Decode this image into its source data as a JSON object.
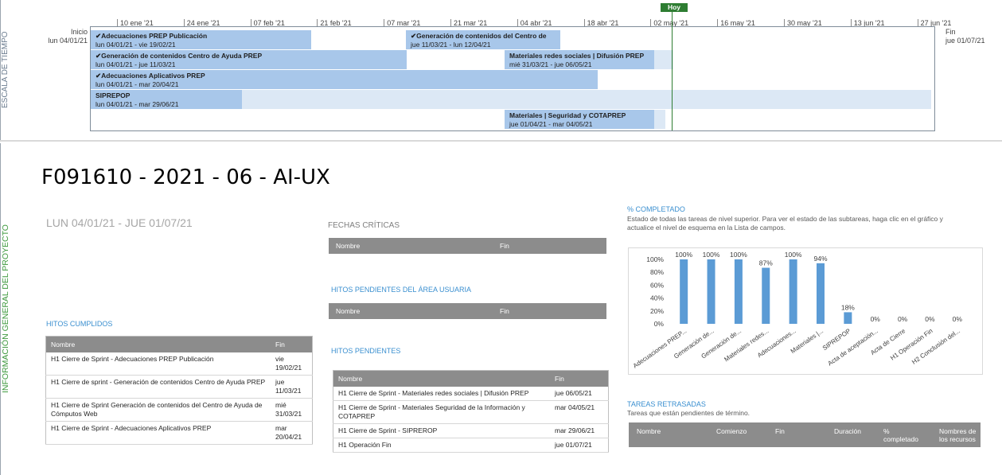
{
  "timeline": {
    "side_label": "ESCALA DE TIEMPO",
    "start_label": "Inicio",
    "start_date": "lun 04/01/21",
    "end_label": "Fin",
    "end_date": "jue 01/07/21",
    "today_label": "Hoy",
    "ticks": [
      "10 ene '21",
      "24 ene '21",
      "07 feb '21",
      "21 feb '21",
      "07 mar '21",
      "21 mar '21",
      "04 abr '21",
      "18 abr '21",
      "02 may '21",
      "16 may '21",
      "30 may '21",
      "13 jun '21",
      "27 jun '21"
    ],
    "bars": [
      {
        "title": "✔Adecuaciones PREP Publicación",
        "dates": "lun 04/01/21 - vie 19/02/21"
      },
      {
        "title": "✔Generación de contenidos del Centro de",
        "dates": "jue 11/03/21 - lun 12/04/21"
      },
      {
        "title": "✔Generación de contenidos Centro de Ayuda PREP",
        "dates": "lun 04/01/21 - jue 11/03/21"
      },
      {
        "title": "Materiales redes sociales | Difusión PREP",
        "dates": "mié 31/03/21 - jue 06/05/21"
      },
      {
        "title": "✔Adecuaciones Aplicativos PREP",
        "dates": "lun 04/01/21 - mar 20/04/21"
      },
      {
        "title": "SIPREPOP",
        "dates": "lun 04/01/21 - mar 29/06/21"
      },
      {
        "title": "Materiales | Seguridad y COTAPREP",
        "dates": "jue 01/04/21 - mar 04/05/21"
      }
    ]
  },
  "report": {
    "side_label": "INFORMACIÓN GENERAL DEL PROYECTO",
    "title": "F091610 - 2021 - 06 - AI-UX",
    "date_range": "LUN 04/01/21 -  JUE 01/07/21",
    "fechas_criticas": {
      "title": "FECHAS CRÍTICAS",
      "col_name": "Nombre",
      "col_end": "Fin"
    },
    "hitos_area": {
      "title": "HITOS PENDIENTES DEL ÁREA USUARIA",
      "col_name": "Nombre",
      "col_end": "Fin"
    },
    "hitos_cumplidos": {
      "title": "HITOS CUMPLIDOS",
      "col_name": "Nombre",
      "col_end": "Fin",
      "rows": [
        {
          "name": "H1 Cierre de Sprint - Adecuaciones PREP Publicación",
          "end": "vie 19/02/21"
        },
        {
          "name": "H1 Cierre de sprint - Generación de contenidos Centro de Ayuda PREP",
          "end": "jue 11/03/21"
        },
        {
          "name": "H1 Cierre de Sprint Generación de contenidos del Centro de Ayuda de Cómputos Web",
          "end": "mié 31/03/21"
        },
        {
          "name": "H1 Cierre de Sprint - Adecuaciones Aplicativos PREP",
          "end": "mar 20/04/21"
        }
      ]
    },
    "hitos_pendientes": {
      "title": "HITOS PENDIENTES",
      "col_name": "Nombre",
      "col_end": "Fin",
      "rows": [
        {
          "name": "H1 Cierre de Sprint - Materiales redes sociales | Difusión PREP",
          "end": "jue 06/05/21"
        },
        {
          "name": "H1 Cierre de Sprint - Materiales Seguridad de la Información y COTAPREP",
          "end": "mar 04/05/21"
        },
        {
          "name": "H1 Cierre de Sprint - SIPREROP",
          "end": "mar 29/06/21"
        },
        {
          "name": "H1 Operación Fin",
          "end": "jue 01/07/21"
        }
      ]
    },
    "completado": {
      "title": "% COMPLETADO",
      "description": "Estado de todas las tareas de nivel superior. Para ver el estado de las subtareas, haga clic en el gráfico y actualice el nivel de esquema en la Lista de campos."
    },
    "tareas_retrasadas": {
      "title": "TAREAS RETRASADAS",
      "subtitle": "Tareas que están pendientes de término.",
      "cols": [
        "Nombre",
        "Comienzo",
        "Fin",
        "Duración",
        "% completado",
        "Nombres de los recursos"
      ]
    }
  },
  "chart_data": {
    "type": "bar",
    "categories": [
      "Adecuaciones PREP...",
      "Generación de...",
      "Generación de...",
      "Materiales redes...",
      "Adecuaciones...",
      "Materiales |...",
      "SIPREPOP",
      "Acta de aceptación...",
      "Acta de Cierre",
      "H1 Operación Fin",
      "H2 Conclusión del..."
    ],
    "values": [
      100,
      100,
      100,
      87,
      100,
      94,
      18,
      0,
      0,
      0,
      0
    ],
    "value_labels": [
      "100%",
      "100%",
      "100%",
      "87%",
      "100%",
      "94%",
      "18%",
      "0%",
      "0%",
      "0%",
      "0%"
    ],
    "y_ticks": [
      "0%",
      "20%",
      "40%",
      "60%",
      "80%",
      "100%"
    ],
    "ylim": [
      0,
      100
    ],
    "bar_color": "#5b9bd5",
    "grid": false
  }
}
